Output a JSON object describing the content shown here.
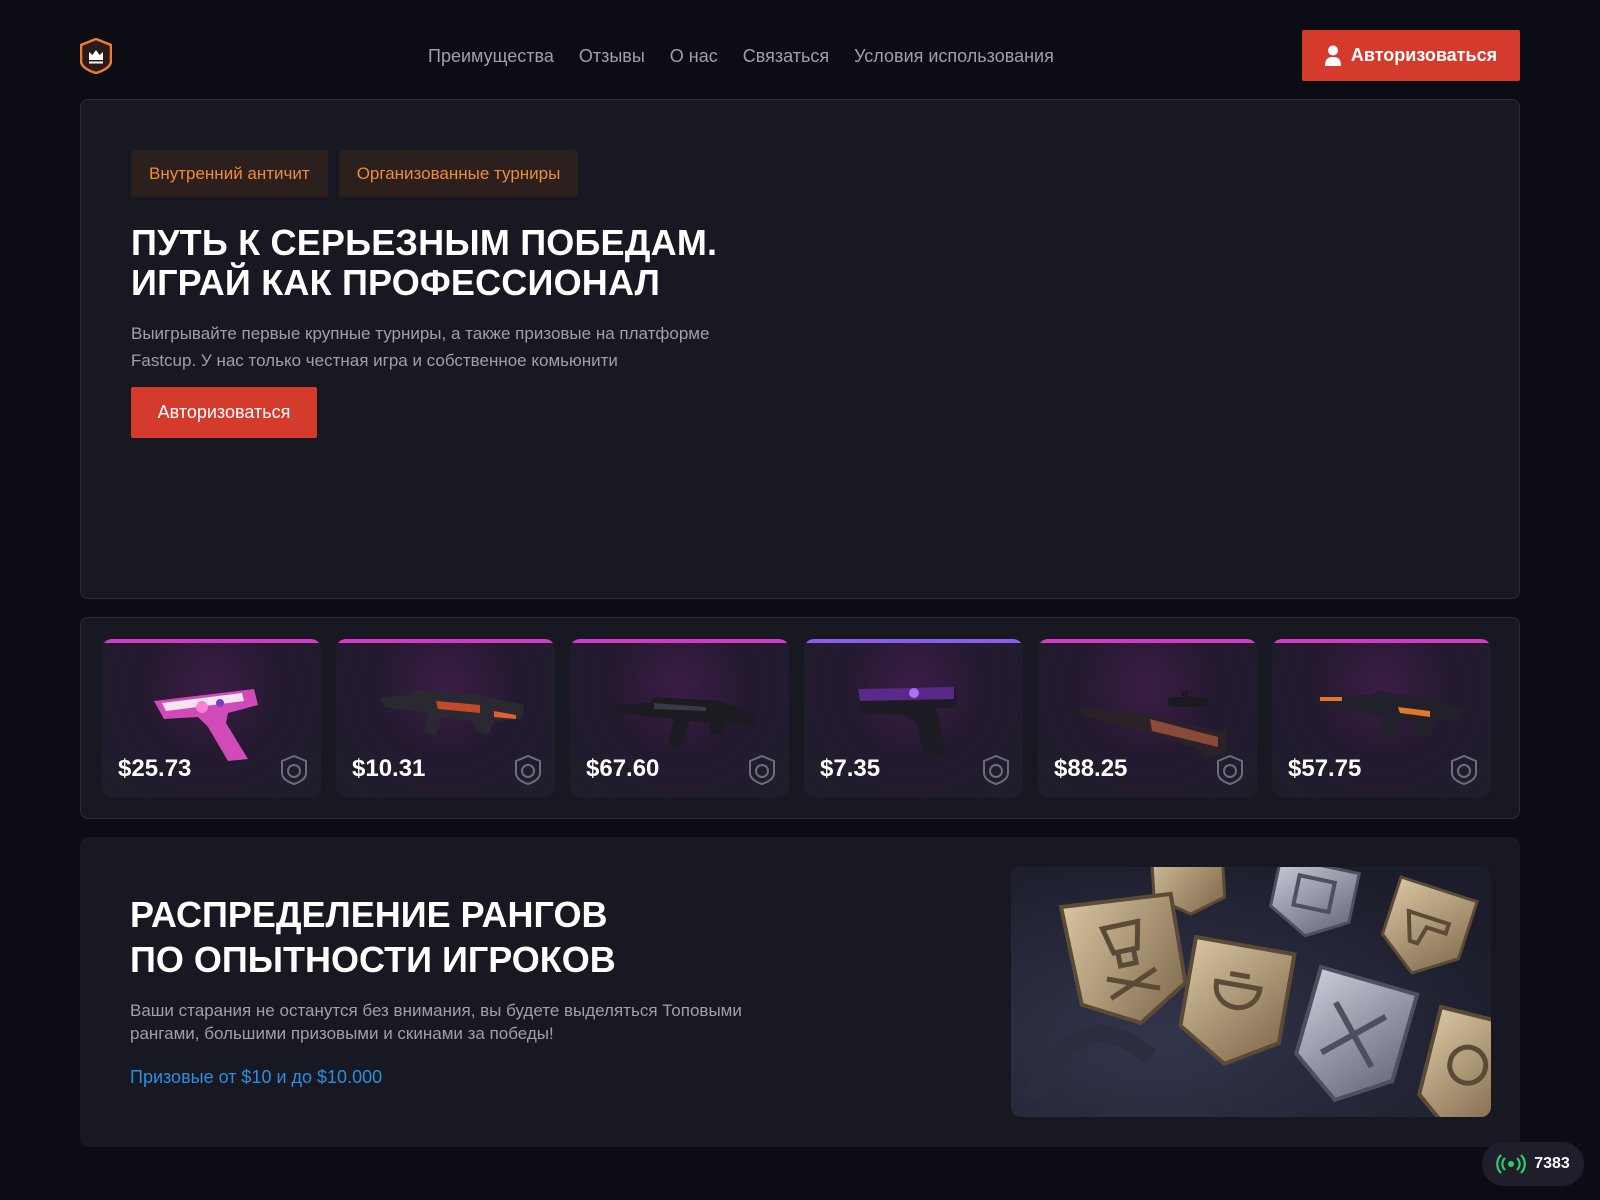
{
  "header": {
    "nav": [
      "Преимущества",
      "Отзывы",
      "О нас",
      "Связаться",
      "Условия использования"
    ],
    "login_label": "Авторизоваться"
  },
  "hero": {
    "tags": [
      "Внутренний античит",
      "Организованные турниры"
    ],
    "title_line1": "ПУТЬ К СЕРЬЕЗНЫМ ПОБЕДАМ.",
    "title_line2": "ИГРАЙ КАК ПРОФЕССИОНАЛ",
    "description": "Выигрывайте первые крупные турниры, а также призовые на платформе Fastcup. У нас только честная игра и собственное комьюнити",
    "button_label": "Авторизоваться"
  },
  "skins": [
    {
      "price": "$25.73",
      "weapon_icon": "pistol-p250-icon",
      "rarity_color": "#d43ac8"
    },
    {
      "price": "$10.31",
      "weapon_icon": "rifle-m4a4-icon",
      "rarity_color": "#d43ac8"
    },
    {
      "price": "$67.60",
      "weapon_icon": "rifle-ak47-icon",
      "rarity_color": "#d43ac8"
    },
    {
      "price": "$7.35",
      "weapon_icon": "pistol-glock-icon",
      "rarity_color": "#8a5cf0"
    },
    {
      "price": "$88.25",
      "weapon_icon": "sniper-awp-icon",
      "rarity_color": "#d43ac8"
    },
    {
      "price": "$57.75",
      "weapon_icon": "rifle-m4a1s-icon",
      "rarity_color": "#d43ac8"
    }
  ],
  "ranks": {
    "title_line1": "РАСПРЕДЕЛЕНИЕ РАНГОВ",
    "title_line2": "ПО ОПЫТНОСТИ ИГРОКОВ",
    "description": "Ваши старания не останутся без внимания, вы будете выделяться Топовыми рангами, большими призовыми и скинами за победы!",
    "prize_text": "Призовые от $10 и до $10.000"
  },
  "online": {
    "count": "7383",
    "icon": "broadcast-icon"
  },
  "colors": {
    "accent": "#d43b2c",
    "tag_text": "#f08a3c",
    "link": "#2a8fe0",
    "online": "#2ecc71"
  }
}
